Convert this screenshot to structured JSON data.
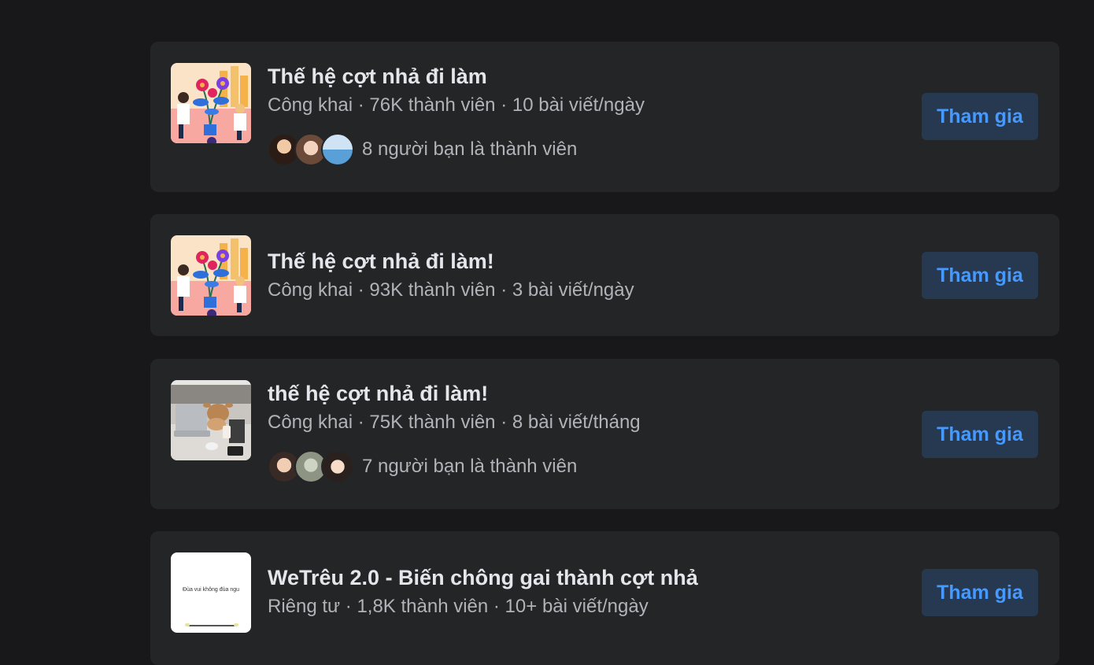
{
  "groups": [
    {
      "name": "Thế hệ cợt nhả đi làm",
      "meta": "Công khai · 76K thành viên · 10 bài viết/ngày",
      "friends_text": "8 người bạn là thành viên",
      "join_label": "Tham gia",
      "thumb": "illustration-flowers"
    },
    {
      "name": "Thế hệ cợt nhả đi làm!",
      "meta": "Công khai · 93K thành viên · 3 bài viết/ngày",
      "friends_text": "",
      "join_label": "Tham gia",
      "thumb": "illustration-flowers"
    },
    {
      "name": "thế hệ cợt nhả đi làm!",
      "meta": "Công khai · 75K thành viên · 8 bài viết/tháng",
      "friends_text": "7 người bạn là thành viên",
      "join_label": "Tham gia",
      "thumb": "photo-cow-at-desk"
    },
    {
      "name": "WeTrêu 2.0 - Biến chông gai thành cợt nhả",
      "meta": "Riêng tư · 1,8K thành viên · 10+ bài viết/ngày",
      "friends_text": "",
      "join_label": "Tham gia",
      "thumb": "white-card",
      "thumb_caption": "Đùa vui không đùa ngu"
    }
  ],
  "colors": {
    "background": "#18181a",
    "card": "#242527",
    "title": "#e4e6eb",
    "secondary_text": "#b0b3b8",
    "join_bg": "#263951",
    "join_text": "#4599ff"
  }
}
